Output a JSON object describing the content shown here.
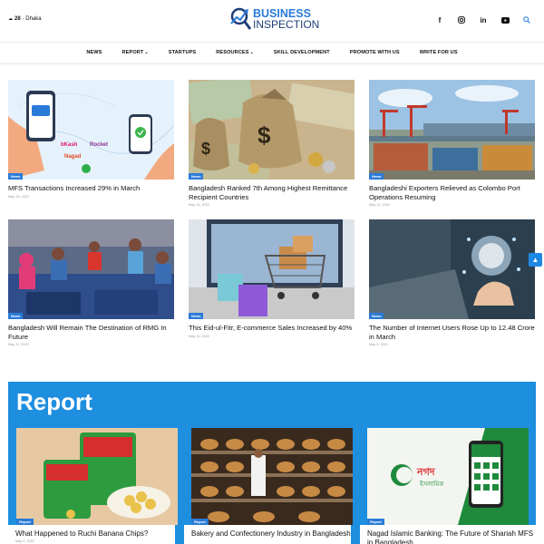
{
  "header": {
    "weather": {
      "temp": "28",
      "unit": "°",
      "city": "Dhaka"
    },
    "logo": {
      "line1": "BUSINESS",
      "line2": "INSPECTION"
    },
    "socials": [
      "facebook-icon",
      "instagram-icon",
      "linkedin-icon",
      "youtube-icon",
      "search-icon"
    ]
  },
  "nav": {
    "items": [
      {
        "label": "NEWS",
        "dropdown": false
      },
      {
        "label": "REPORT",
        "dropdown": true
      },
      {
        "label": "STARTUPS",
        "dropdown": false
      },
      {
        "label": "RESOURCES",
        "dropdown": true
      },
      {
        "label": "SKILL DEVELOPMENT",
        "dropdown": false
      },
      {
        "label": "PROMOTE WITH US",
        "dropdown": false
      },
      {
        "label": "WRITE FOR US",
        "dropdown": false
      }
    ],
    "caret": "⌄"
  },
  "articles": [
    {
      "badge": "News",
      "title": "MFS Transactions Increased 29% in March",
      "date": "May 15, 2022",
      "thumb_text": [
        "bKash",
        "Rocket",
        "Nagad"
      ]
    },
    {
      "badge": "News",
      "title": "Bangladesh Ranked 7th Among Highest Remittance Recipient Countries",
      "date": "May 14, 2022"
    },
    {
      "badge": "News",
      "title": "Bangladeshi Exporters Relieved as Colombo Port Operations Resuming",
      "date": "May 12, 2022"
    },
    {
      "badge": "News",
      "title": "Bangladesh Will Remain The Destination of RMG In Future",
      "date": "May 11, 2022"
    },
    {
      "badge": "News",
      "title": "This Eid-ul-Fitr, E-commerce Sales Increased by 40%",
      "date": "May 10, 2022"
    },
    {
      "badge": "News",
      "title": "The Number of Internet Users Rose Up to 12.48 Crore in March",
      "date": "May 9, 2022"
    }
  ],
  "report": {
    "title": "Report",
    "cards": [
      {
        "badge": "Report",
        "title": "What Happened to Ruchi Banana Chips?",
        "date": "May 4, 2022"
      },
      {
        "badge": "Report",
        "title": "Bakery and Confectionery Industry in Bangladesh",
        "date": ""
      },
      {
        "badge": "Report",
        "title": "Nagad Islamic Banking: The Future of Shariah MFS in Bangladesh",
        "date": ""
      }
    ]
  },
  "colors": {
    "accent": "#2a7bd8",
    "band": "#1e8ede",
    "logo_dark": "#1f3f78"
  }
}
